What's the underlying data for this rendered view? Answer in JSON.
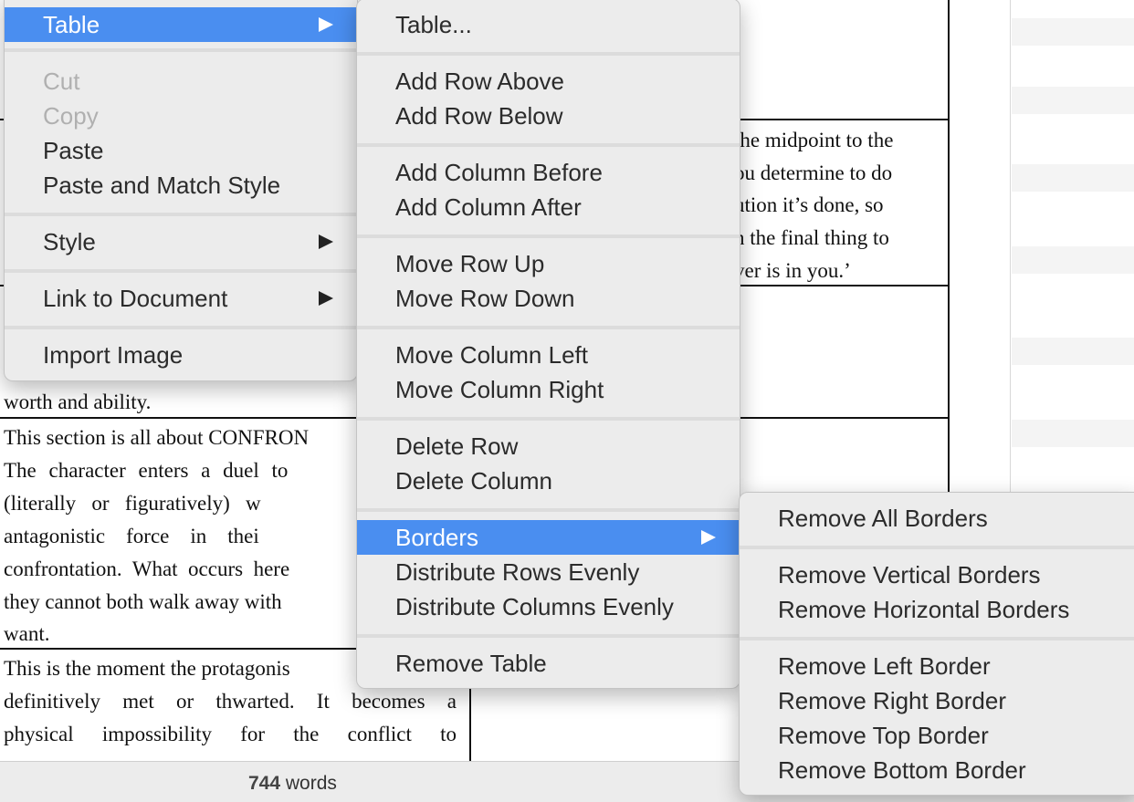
{
  "document": {
    "right_cell_lines": [
      "the midpoint to the",
      "ou determine to do",
      "ution it’s done, so",
      "n the final thing to",
      "ver is in you.’"
    ],
    "left_lines_a": [
      "worth and ability."
    ],
    "left_lines_b": [
      "This section is all about CONFRON",
      "The character enters a duel to",
      "(literally   or   figuratively)   w",
      "antagonistic    force    in    thei",
      "confrontation.  What  occurs  here",
      "they cannot both walk away with",
      "want."
    ],
    "left_lines_c": [
      "This is the moment the protagonis",
      "definitively met or thwarted. It becomes a",
      "physical impossibility for the conflict to"
    ]
  },
  "statusbar": {
    "word_count": "744",
    "word_label": "words"
  },
  "context_menu": {
    "items": [
      {
        "label": "Table",
        "selected": true,
        "submenu": true
      },
      {
        "label": "Cut",
        "disabled": true
      },
      {
        "label": "Copy",
        "disabled": true
      },
      {
        "label": "Paste"
      },
      {
        "label": "Paste and Match Style"
      },
      {
        "label": "Style",
        "submenu": true
      },
      {
        "label": "Link to Document",
        "submenu": true
      },
      {
        "label": "Import Image"
      }
    ]
  },
  "table_menu": {
    "items": [
      {
        "label": "Table..."
      },
      {
        "label": "Add Row Above"
      },
      {
        "label": "Add Row Below"
      },
      {
        "label": "Add Column Before"
      },
      {
        "label": "Add Column After"
      },
      {
        "label": "Move Row Up"
      },
      {
        "label": "Move Row Down"
      },
      {
        "label": "Move Column Left"
      },
      {
        "label": "Move Column Right"
      },
      {
        "label": "Delete Row"
      },
      {
        "label": "Delete Column"
      },
      {
        "label": "Borders",
        "selected": true,
        "submenu": true
      },
      {
        "label": "Distribute Rows Evenly"
      },
      {
        "label": "Distribute Columns Evenly"
      },
      {
        "label": "Remove Table"
      }
    ]
  },
  "borders_menu": {
    "items": [
      {
        "label": "Remove All Borders"
      },
      {
        "label": "Remove Vertical Borders"
      },
      {
        "label": "Remove Horizontal Borders"
      },
      {
        "label": "Remove Left Border"
      },
      {
        "label": "Remove Right Border"
      },
      {
        "label": "Remove Top Border"
      },
      {
        "label": "Remove Bottom Border"
      }
    ]
  },
  "colors": {
    "selection": "#4a8ef0",
    "menu_bg": "#ececec"
  }
}
